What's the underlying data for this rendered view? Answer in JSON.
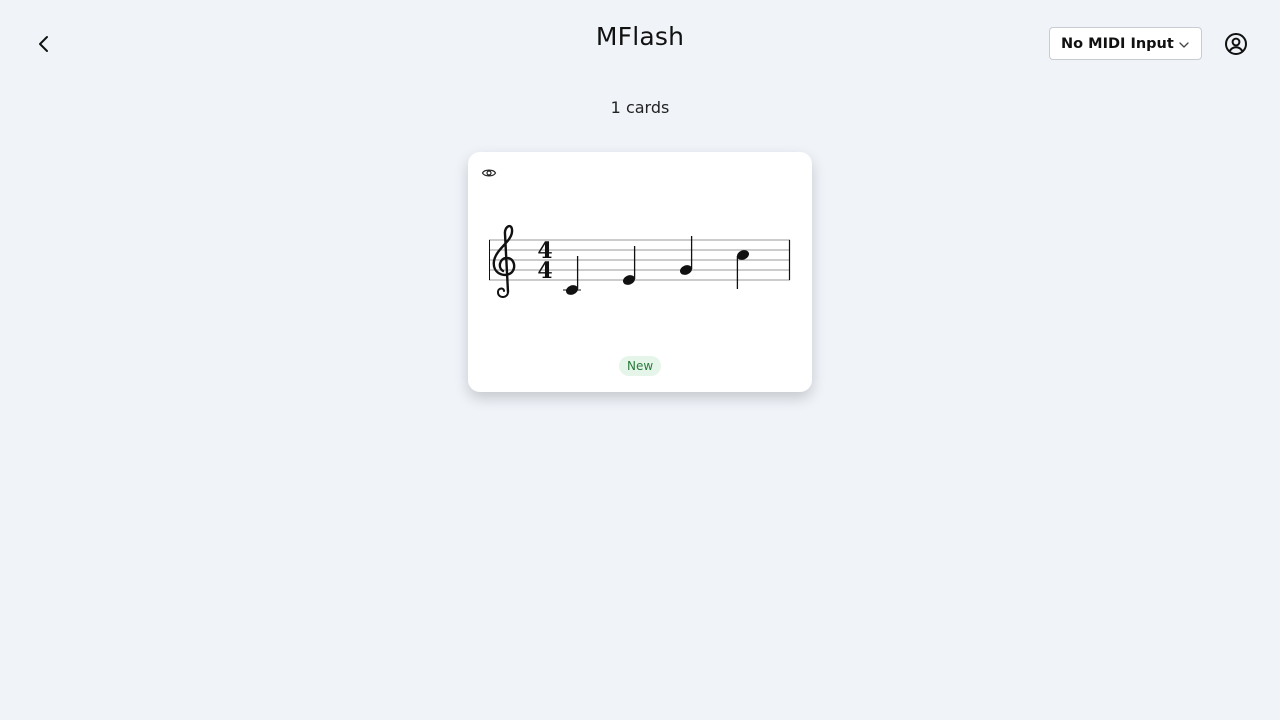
{
  "header": {
    "title": "MFlash",
    "back_icon": "chevron-left-icon",
    "midi_select": {
      "selected": "No MIDI Input",
      "icon": "chevron-down-icon"
    },
    "account_icon": "user-circle-icon"
  },
  "deck": {
    "count_label": "1 cards"
  },
  "card": {
    "icon": "eye-icon",
    "clef": "treble",
    "time_signature": {
      "top": "4",
      "bottom": "4"
    },
    "notes": [
      "C4",
      "E4",
      "G4",
      "C5"
    ],
    "note_duration": "quarter",
    "status": "New"
  },
  "colors": {
    "background": "#f0f4f9",
    "card": "#ffffff",
    "badge_bg": "#e6f5ea",
    "badge_text": "#2a7a3c"
  }
}
